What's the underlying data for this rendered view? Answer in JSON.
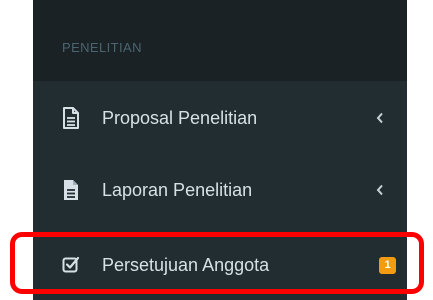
{
  "sidebar": {
    "section_header": "PENELITIAN",
    "items": [
      {
        "label": "Proposal Penelitian",
        "icon": "file-text-outline-icon",
        "has_submenu": true
      },
      {
        "label": "Laporan Penelitian",
        "icon": "file-text-solid-icon",
        "has_submenu": true
      },
      {
        "label": "Persetujuan Anggota",
        "icon": "check-square-icon",
        "badge": "1"
      }
    ]
  },
  "colors": {
    "sidebar_bg": "#222d32",
    "header_bg": "#1a2226",
    "badge_bg": "#f39c12",
    "highlight": "#ff0000"
  }
}
